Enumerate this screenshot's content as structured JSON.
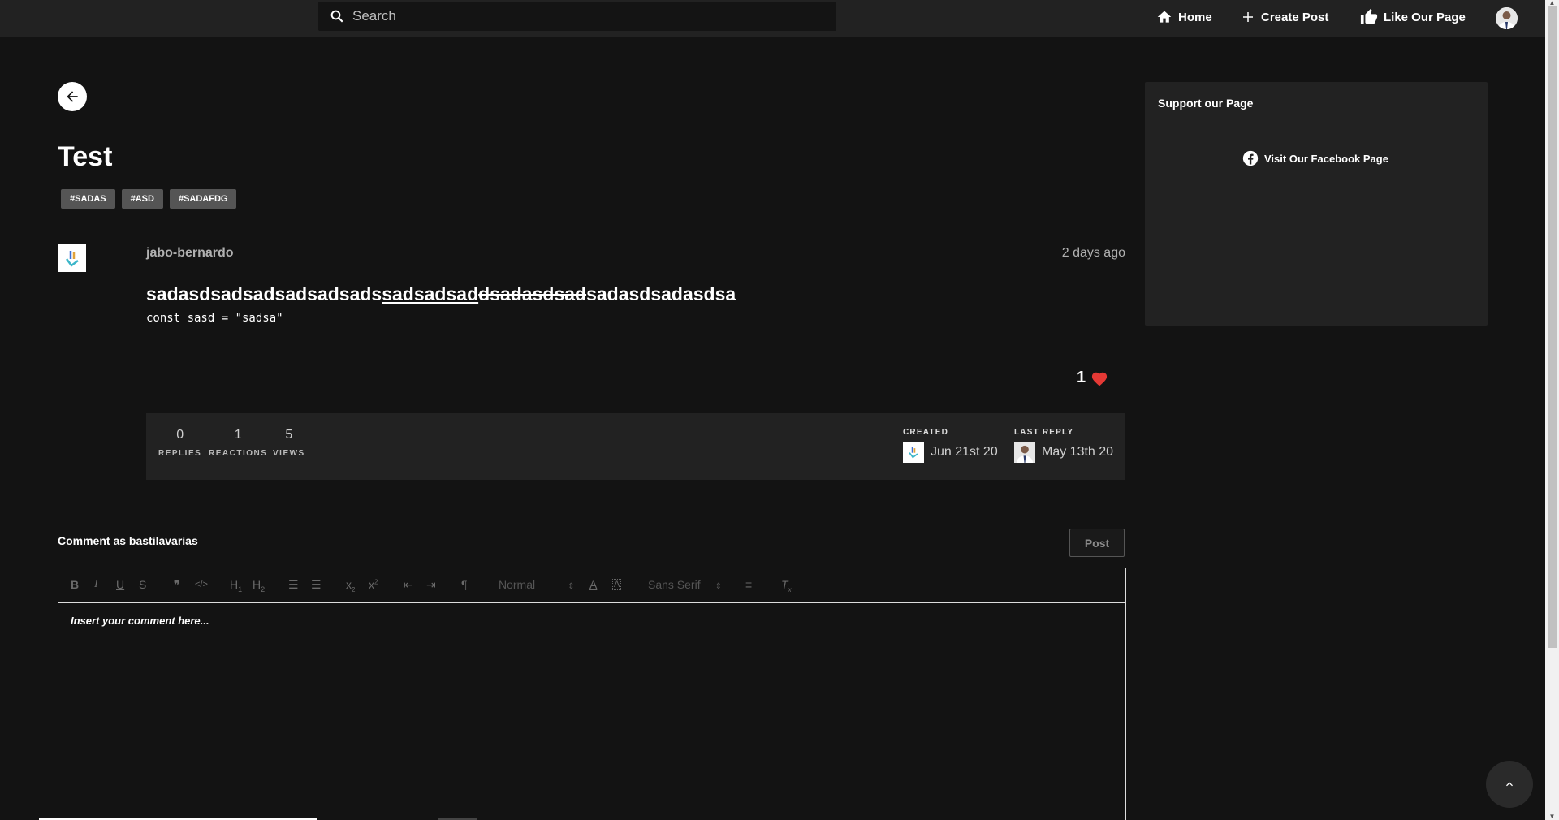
{
  "search": {
    "placeholder": "Search"
  },
  "nav": {
    "home": "Home",
    "create_post": "Create Post",
    "like_page": "Like Our Page"
  },
  "post": {
    "title": "Test",
    "tags": [
      "#SADAS",
      "#ASD",
      "#SADAFDG"
    ],
    "author": "jabo-bernardo",
    "time": "2 days ago",
    "content": {
      "plain_start": "sadasdsadsadsadsadsads",
      "underlined": "sadsadsad",
      "struck": "dsadasdsad",
      "plain_end": "sadasdsadasdsa"
    },
    "code": "const sasd = \"sadsa\"",
    "likes": "1"
  },
  "stats": {
    "replies": {
      "value": "0",
      "label": "REPLIES"
    },
    "reactions": {
      "value": "1",
      "label": "REACTIONS"
    },
    "views": {
      "value": "5",
      "label": "VIEWS"
    },
    "created": {
      "label": "CREATED",
      "date": "Jun 21st 20"
    },
    "last_reply": {
      "label": "LAST REPLY",
      "date": "May 13th 20"
    }
  },
  "comment": {
    "as_label": "Comment as bastilavarias",
    "post_button": "Post",
    "placeholder": "Insert your comment here...",
    "toolbar": {
      "header_select": "Normal",
      "font_select": "Sans Serif"
    }
  },
  "sidebar": {
    "title": "Support our Page",
    "facebook_link": "Visit Our Facebook Page"
  },
  "colors": {
    "background": "#131313",
    "panel": "#222222",
    "heart": "#e53935"
  }
}
